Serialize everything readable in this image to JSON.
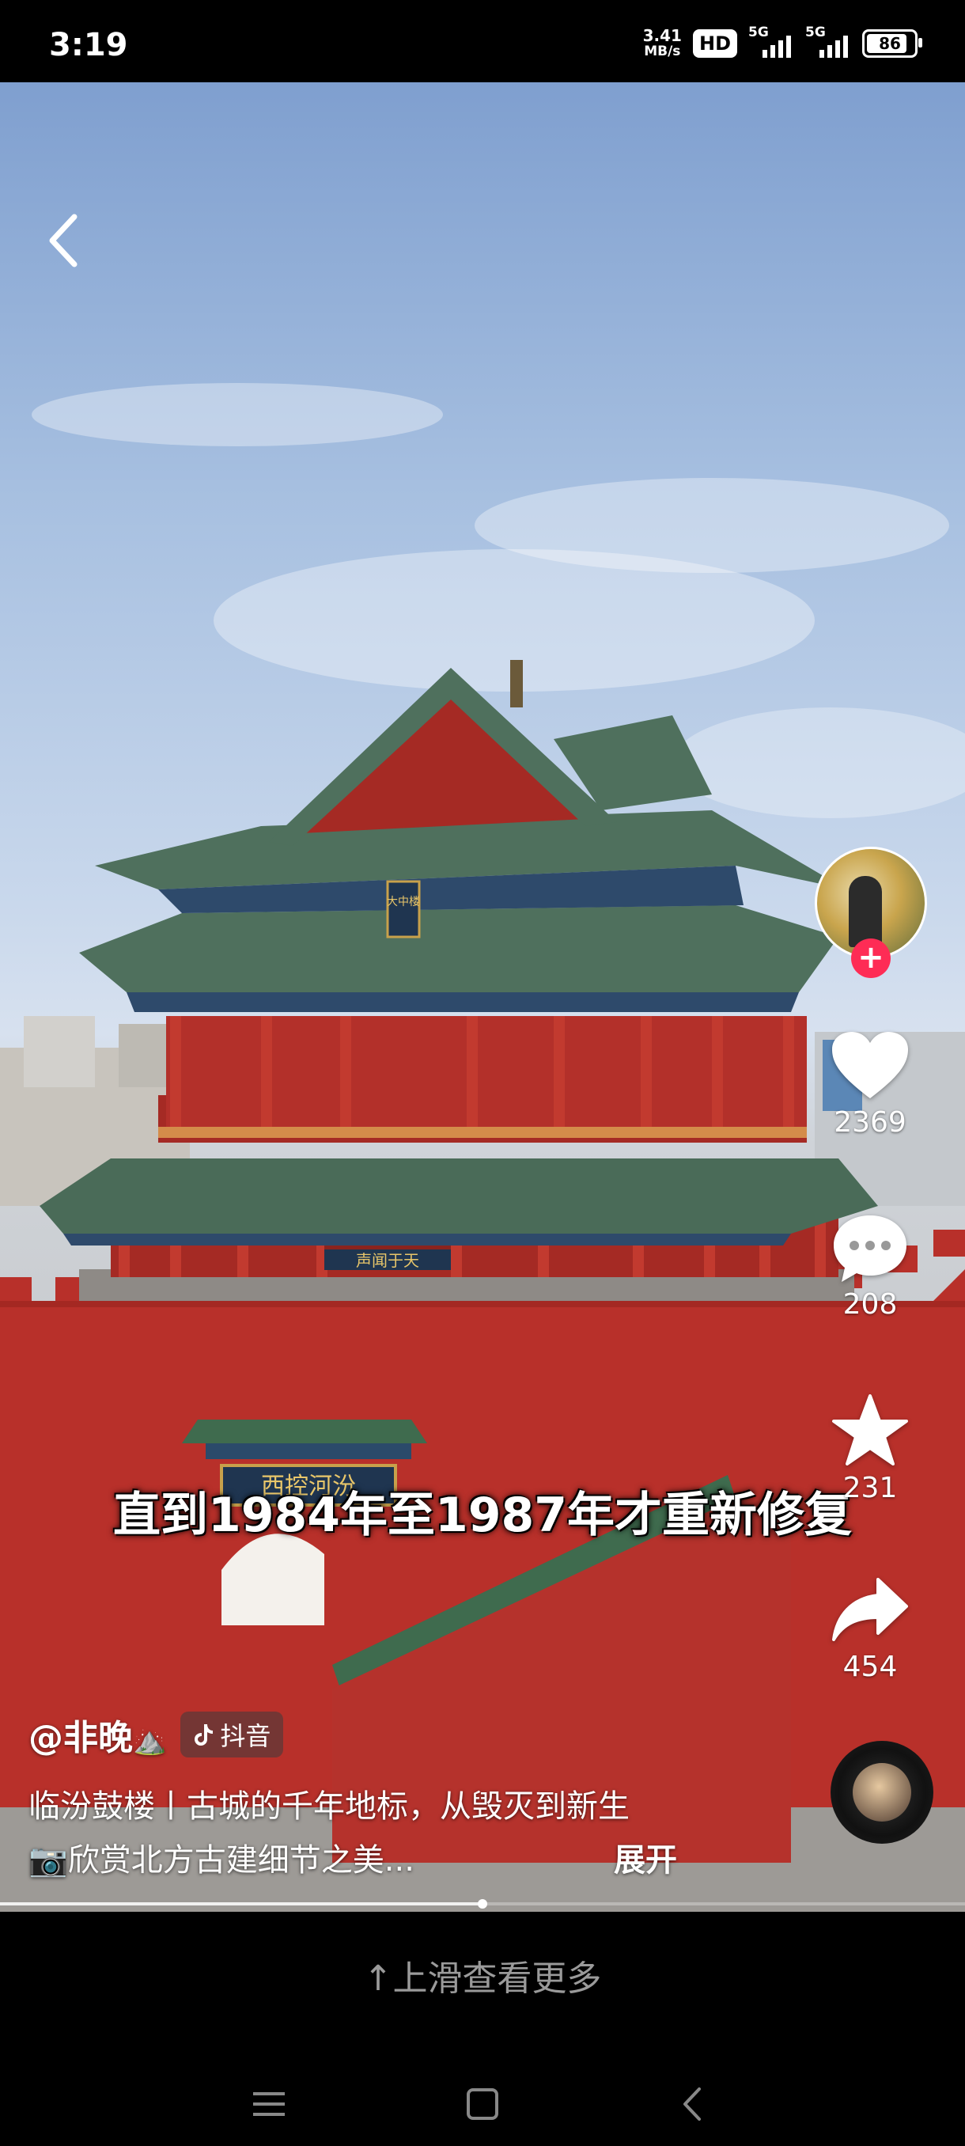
{
  "status_bar": {
    "time": "3:19",
    "net_speed_value": "3.41",
    "net_speed_unit": "MB/s",
    "hd_badge": "HD",
    "signal1_label": "5G",
    "signal2_label": "5G",
    "battery_level": "86"
  },
  "video": {
    "caption": "直到1984年至1987年才重新修复",
    "plaque_top": "大中楼",
    "plaque_middle": "声闻于天",
    "plaque_gate": "西控河汾",
    "progress": 0.5
  },
  "sidebar": {
    "likes": "2369",
    "comments": "208",
    "favorites": "231",
    "shares": "454"
  },
  "info": {
    "author": "@非晚",
    "author_emoji": "⛰️",
    "platform_tag": "抖音",
    "description_line1": "临汾鼓楼丨古城的千年地标，从毁灭到新生",
    "description_line2": "📷欣赏北方古建细节之美...",
    "expand_label": "展开"
  },
  "footer": {
    "swipe_hint": "上滑查看更多"
  },
  "colors": {
    "accent": "#fe2c55",
    "wall_red": "#b8302a"
  }
}
